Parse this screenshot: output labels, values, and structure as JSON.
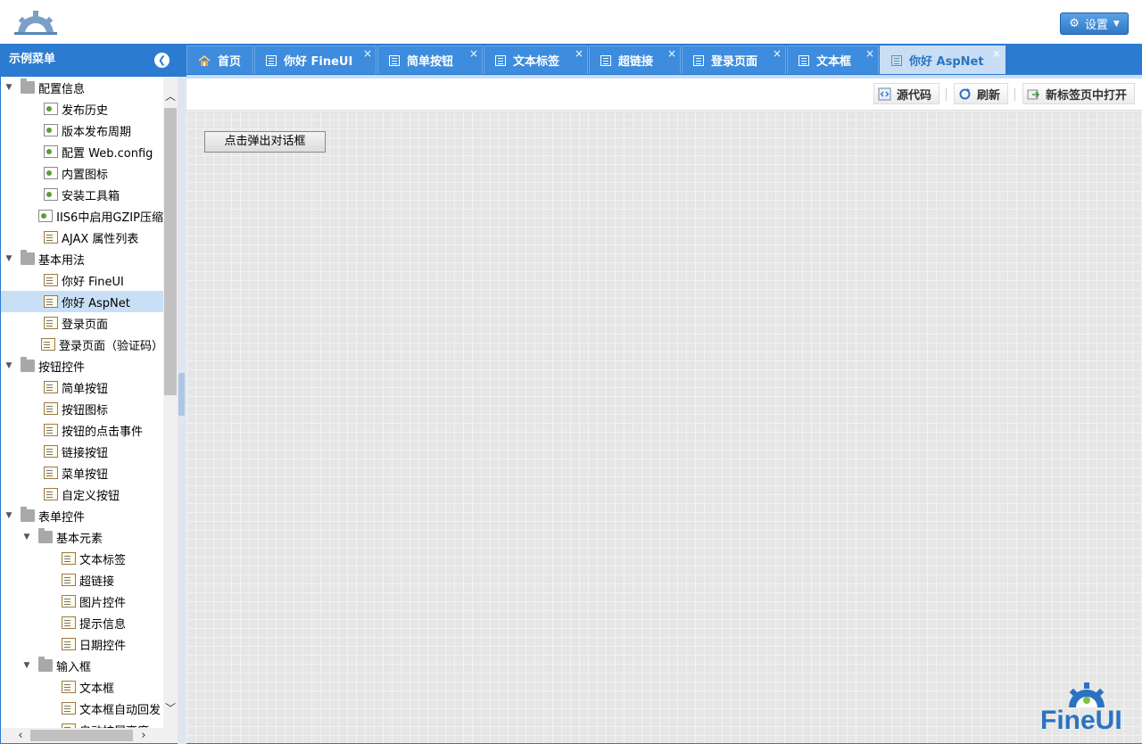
{
  "header": {
    "settings_label": "设置"
  },
  "sidebar": {
    "title": "示例菜单",
    "items": [
      {
        "label": "配置信息",
        "type": "folder",
        "level": 0
      },
      {
        "label": "发布历史",
        "type": "page",
        "level": 1
      },
      {
        "label": "版本发布周期",
        "type": "page",
        "level": 1
      },
      {
        "label": "配置 Web.config",
        "type": "page",
        "level": 1
      },
      {
        "label": "内置图标",
        "type": "page",
        "level": 1
      },
      {
        "label": "安装工具箱",
        "type": "page",
        "level": 1
      },
      {
        "label": "IIS6中启用GZIP压缩",
        "type": "page",
        "level": 1
      },
      {
        "label": "AJAX 属性列表",
        "type": "form",
        "level": 1
      },
      {
        "label": "基本用法",
        "type": "folder",
        "level": 0
      },
      {
        "label": "你好 FineUI",
        "type": "form",
        "level": 1
      },
      {
        "label": "你好 AspNet",
        "type": "form",
        "level": 1,
        "selected": true
      },
      {
        "label": "登录页面",
        "type": "form",
        "level": 1
      },
      {
        "label": "登录页面（验证码）",
        "type": "form",
        "level": 1
      },
      {
        "label": "按钮控件",
        "type": "folder",
        "level": 0
      },
      {
        "label": "简单按钮",
        "type": "form",
        "level": 1
      },
      {
        "label": "按钮图标",
        "type": "form",
        "level": 1
      },
      {
        "label": "按钮的点击事件",
        "type": "form",
        "level": 1
      },
      {
        "label": "链接按钮",
        "type": "form",
        "level": 1
      },
      {
        "label": "菜单按钮",
        "type": "form",
        "level": 1
      },
      {
        "label": "自定义按钮",
        "type": "form",
        "level": 1
      },
      {
        "label": "表单控件",
        "type": "folder",
        "level": 0
      },
      {
        "label": "基本元素",
        "type": "folder",
        "level": 1
      },
      {
        "label": "文本标签",
        "type": "form",
        "level": 2
      },
      {
        "label": "超链接",
        "type": "form",
        "level": 2
      },
      {
        "label": "图片控件",
        "type": "form",
        "level": 2
      },
      {
        "label": "提示信息",
        "type": "form",
        "level": 2
      },
      {
        "label": "日期控件",
        "type": "form",
        "level": 2
      },
      {
        "label": "输入框",
        "type": "folder",
        "level": 1
      },
      {
        "label": "文本框",
        "type": "form",
        "level": 2
      },
      {
        "label": "文本框自动回发",
        "type": "form",
        "level": 2
      },
      {
        "label": "自动扩展高度",
        "type": "form",
        "level": 2
      }
    ]
  },
  "tabs": [
    {
      "label": "首页",
      "icon": "home-icon",
      "closable": false,
      "active": false
    },
    {
      "label": "你好 FineUI",
      "icon": "page-icon",
      "closable": true,
      "active": false
    },
    {
      "label": "简单按钮",
      "icon": "page-icon",
      "closable": true,
      "active": false
    },
    {
      "label": "文本标签",
      "icon": "page-icon",
      "closable": true,
      "active": false
    },
    {
      "label": "超链接",
      "icon": "page-icon",
      "closable": true,
      "active": false
    },
    {
      "label": "登录页面",
      "icon": "page-icon",
      "closable": true,
      "active": false
    },
    {
      "label": "文本框",
      "icon": "page-icon",
      "closable": true,
      "active": false
    },
    {
      "label": "你好 AspNet",
      "icon": "page-icon",
      "closable": true,
      "active": true
    }
  ],
  "toolbar": {
    "source_label": "源代码",
    "refresh_label": "刷新",
    "open_new_tab_label": "新标签页中打开"
  },
  "content": {
    "popup_button_label": "点击弹出对话框"
  },
  "brand": {
    "logo_text": "FineUI",
    "accent": "#2b7bd0"
  }
}
